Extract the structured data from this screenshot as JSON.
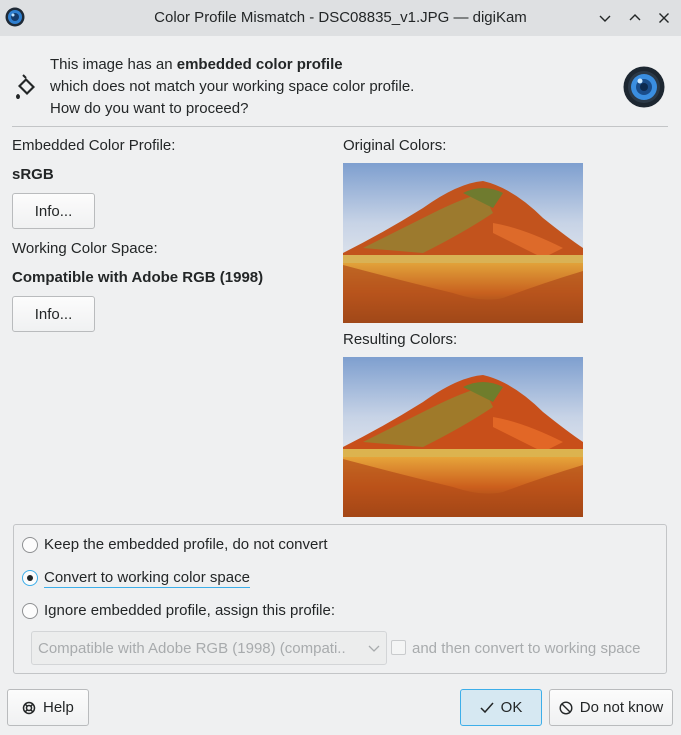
{
  "window": {
    "title": "Color Profile Mismatch - DSC08835_v1.JPG — digiKam",
    "app_icon": "digikam-icon",
    "controls": [
      "minimize-icon",
      "maximize-icon",
      "close-icon"
    ]
  },
  "header": {
    "line1_prefix": "This image has an ",
    "line1_bold": "embedded color profile",
    "line2": "which does not match your working space color profile.",
    "line3": "How do you want to proceed?",
    "icon": "paint-bucket-icon",
    "logo": "digikam-lens-icon"
  },
  "embedded": {
    "label": "Embedded Color Profile:",
    "value": "sRGB",
    "info_button": "Info..."
  },
  "working": {
    "label": "Working Color Space:",
    "value": "Compatible with Adobe RGB (1998)",
    "info_button": "Info..."
  },
  "previews": {
    "original_label": "Original Colors:",
    "resulting_label": "Resulting Colors:"
  },
  "options": {
    "keep": "Keep the embedded profile, do not convert",
    "convert": "Convert to working color space",
    "ignore": "Ignore embedded profile, assign this profile:",
    "selected": "convert",
    "profile_combo": "Compatible with Adobe RGB (1998) (compati..",
    "then_convert": "and then convert to working space"
  },
  "footer": {
    "help": "Help",
    "ok": "OK",
    "do_not_know": "Do not know"
  },
  "colors": {
    "accent": "#3daee9",
    "ok_background": "#d6e8f2"
  }
}
